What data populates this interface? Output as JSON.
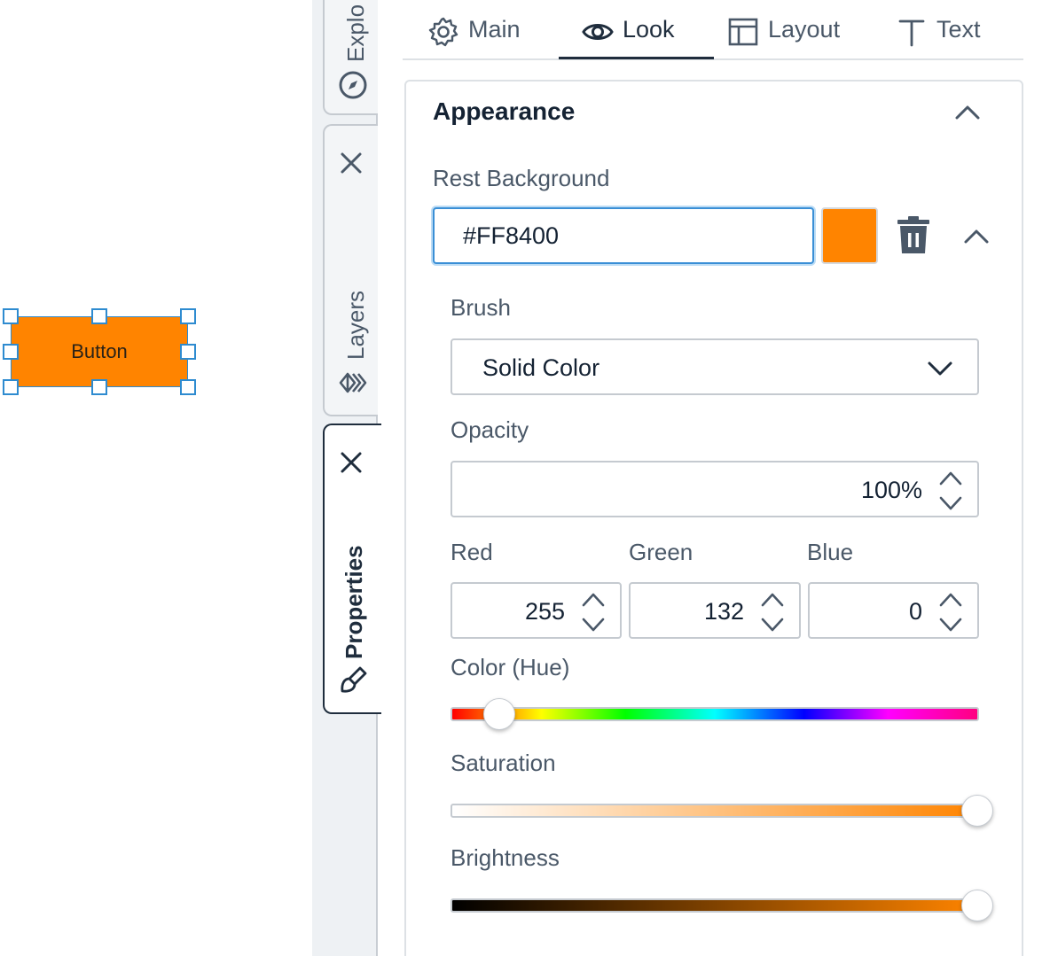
{
  "canvas": {
    "button_label": "Button",
    "button_color": "#FF8400",
    "selection_color": "#2E8BD0"
  },
  "side_tabs": {
    "explorer": {
      "label": "Explo",
      "icon": "compass-icon"
    },
    "layers": {
      "label": "Layers",
      "icon": "layers-icon",
      "close_icon": "close-icon"
    },
    "properties": {
      "label": "Properties",
      "icon": "brush-icon",
      "close_icon": "close-icon",
      "active": true
    }
  },
  "tabs": [
    {
      "label": "Main",
      "icon": "gear-icon"
    },
    {
      "label": "Look",
      "icon": "eye-icon",
      "active": true
    },
    {
      "label": "Layout",
      "icon": "layout-icon"
    },
    {
      "label": "Text",
      "icon": "text-icon"
    }
  ],
  "appearance": {
    "title": "Appearance",
    "rest_background": {
      "label": "Rest Background",
      "hex_value": "#FF8400",
      "swatch_color": "#FF8400"
    },
    "brush": {
      "label": "Brush",
      "value": "Solid Color"
    },
    "opacity": {
      "label": "Opacity",
      "value": "100%"
    },
    "red": {
      "label": "Red",
      "value": "255"
    },
    "green": {
      "label": "Green",
      "value": "132"
    },
    "blue": {
      "label": "Blue",
      "value": "0"
    },
    "hue": {
      "label": "Color (Hue)",
      "level": 0.09
    },
    "saturation": {
      "label": "Saturation",
      "level": 1.0
    },
    "brightness": {
      "label": "Brightness",
      "level": 1.0
    }
  },
  "colors": {
    "accent": "#3A8FD6",
    "text_primary": "#142233",
    "text_secondary": "#4A5868",
    "border": "#C5CAD0"
  }
}
